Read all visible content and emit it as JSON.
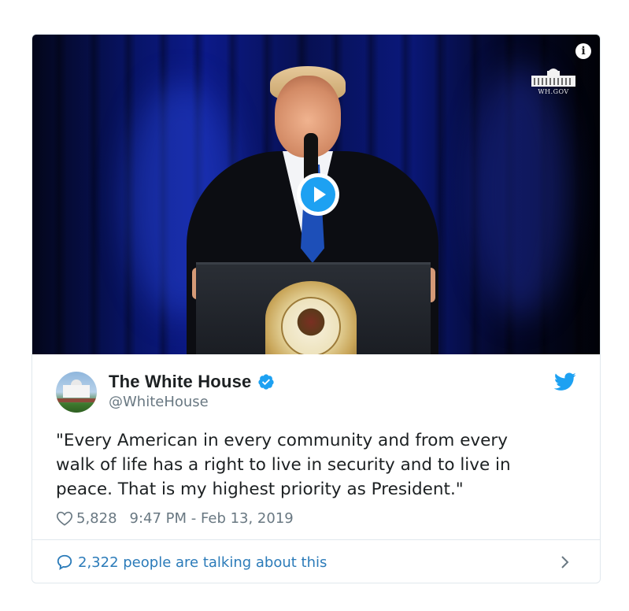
{
  "media": {
    "watermark_text": "WH.GOV",
    "info_glyph": "i",
    "play_icon": "play-icon",
    "seal_icon": "presidential-seal-icon"
  },
  "tweet": {
    "display_name": "The White House",
    "handle": "@WhiteHouse",
    "verified_icon": "verified-badge-icon",
    "brand_icon": "twitter-bird-icon",
    "text_lines": [
      "\"Every American in every community and from every",
      "walk of life has a right to live in security and to live in",
      "peace. That is my highest priority as President.\""
    ],
    "like_count": "5,828",
    "timestamp": "9:47 PM - Feb 13, 2019",
    "conversation_text": "2,322 people are talking about this"
  },
  "colors": {
    "twitter_blue": "#1da1f2",
    "link_blue": "#2b7bb9",
    "text": "#1c2022",
    "muted": "#697882",
    "border": "#e1e8ed"
  }
}
